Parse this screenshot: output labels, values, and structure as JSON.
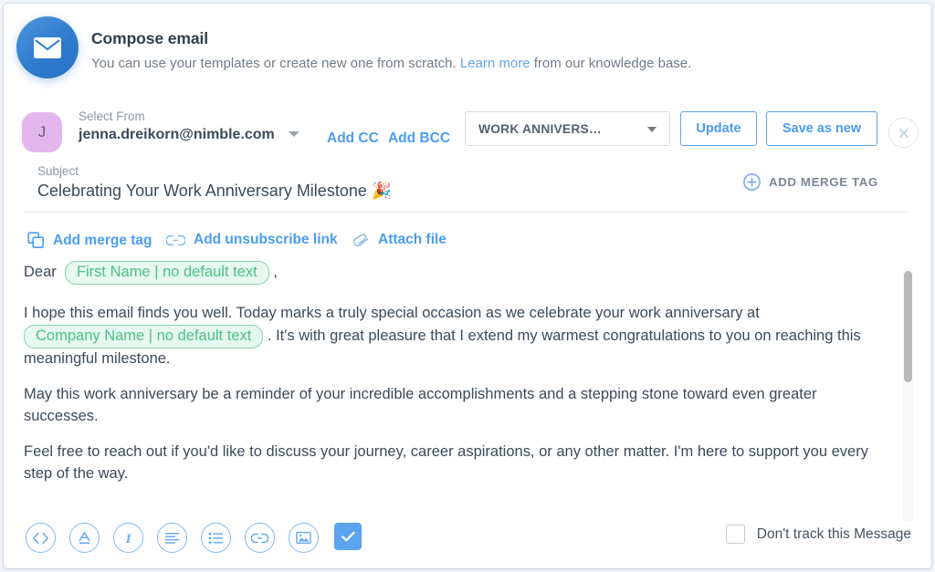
{
  "header": {
    "icon": "envelope-icon",
    "title": "Compose email",
    "subtitle_before": "You can use your templates or create new one from scratch. ",
    "subtitle_link": "Learn more",
    "subtitle_after": " from our knowledge base."
  },
  "from": {
    "avatar_initial": "J",
    "label": "Select From",
    "value": "jenna.dreikorn@nimble.com",
    "add_cc": "Add CC",
    "add_bcc": "Add BCC"
  },
  "template": {
    "selected": "WORK ANNIVERS…",
    "update_label": "Update",
    "save_as_new_label": "Save as new"
  },
  "subject": {
    "label": "Subject",
    "value": "Celebrating Your Work Anniversary Milestone 🎉",
    "add_merge_tag_label": "ADD MERGE TAG"
  },
  "link_toolbar": {
    "add_merge_tag": "Add merge tag",
    "add_unsubscribe_link": "Add unsubscribe link",
    "attach_file": "Attach file"
  },
  "body": {
    "greeting_prefix": "Dear",
    "greeting_tag": "First Name | no default text",
    "greeting_suffix": ",",
    "p1_before": "I hope this email finds you well. Today marks a truly special occasion as we celebrate your work anniversary at",
    "p1_tag": "Company Name | no default text",
    "p1_after": ". It's with great pleasure that I extend my warmest congratulations to you on reaching this meaningful milestone.",
    "p2": "May this work anniversary be a reminder of your incredible accomplishments and a stepping stone toward even greater successes.",
    "p3": "Feel free to reach out if you'd like to discuss your journey, career aspirations, or any other matter. I'm here to support you every step of the way."
  },
  "bottom_toolbar": {
    "icons": [
      "code-icon",
      "text-color-icon",
      "italic-icon",
      "align-left-icon",
      "bullet-list-icon",
      "link-icon",
      "image-icon",
      "checkmark-icon"
    ],
    "dont_track_label": "Don't track this Message",
    "dont_track_checked": false
  },
  "colors": {
    "accent_blue": "#4a9df0",
    "merge_tag_green": "#4cc08a",
    "avatar_purple": "#e4b6ee",
    "text_dark": "#3c4a58",
    "text_muted": "#8f98a3"
  }
}
